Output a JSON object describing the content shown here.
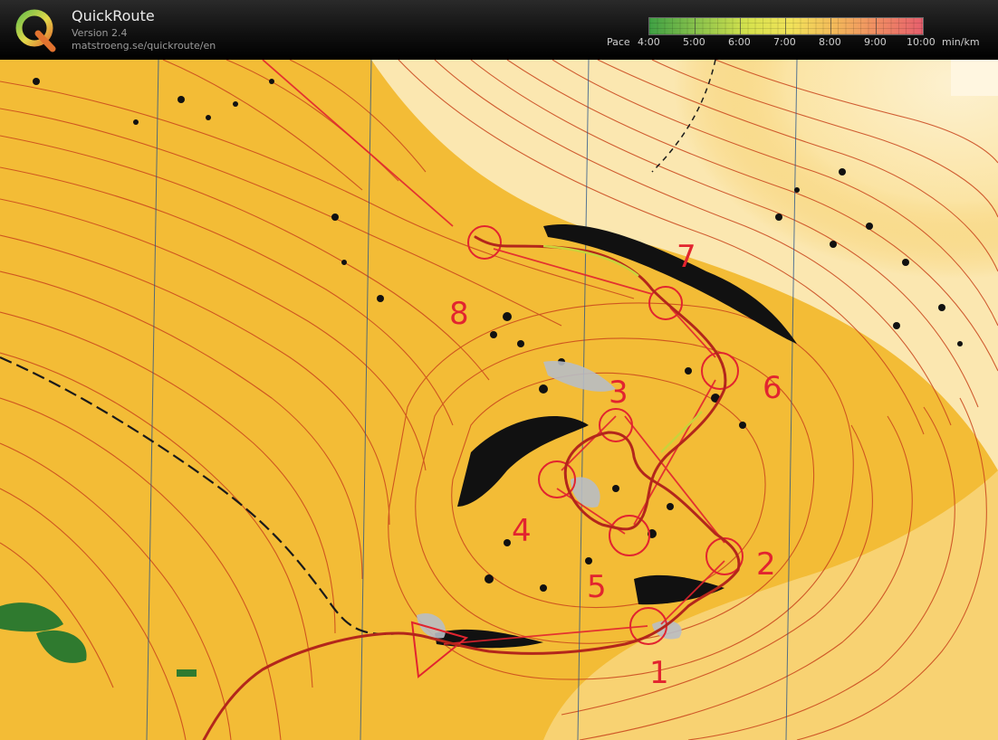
{
  "app": {
    "title": "QuickRoute",
    "version": "Version 2.4",
    "url": "matstroeng.se/quickroute/en"
  },
  "pace_scale": {
    "prefix": "Pace",
    "ticks": [
      "4:00",
      "5:00",
      "6:00",
      "7:00",
      "8:00",
      "9:00",
      "10:00"
    ],
    "unit": "min/km",
    "colors": [
      "#3fa044",
      "#8cc34c",
      "#d6e24d",
      "#f1e25a",
      "#f3b85a",
      "#ef8a63",
      "#e65f6d"
    ]
  },
  "map": {
    "base_color": "#f3bc36",
    "contour_color": "#c9451c",
    "course_color": "#e2242f",
    "route_color": "#b3261b",
    "control_numbers": [
      "1",
      "2",
      "3",
      "4",
      "5",
      "6",
      "7",
      "8"
    ]
  }
}
